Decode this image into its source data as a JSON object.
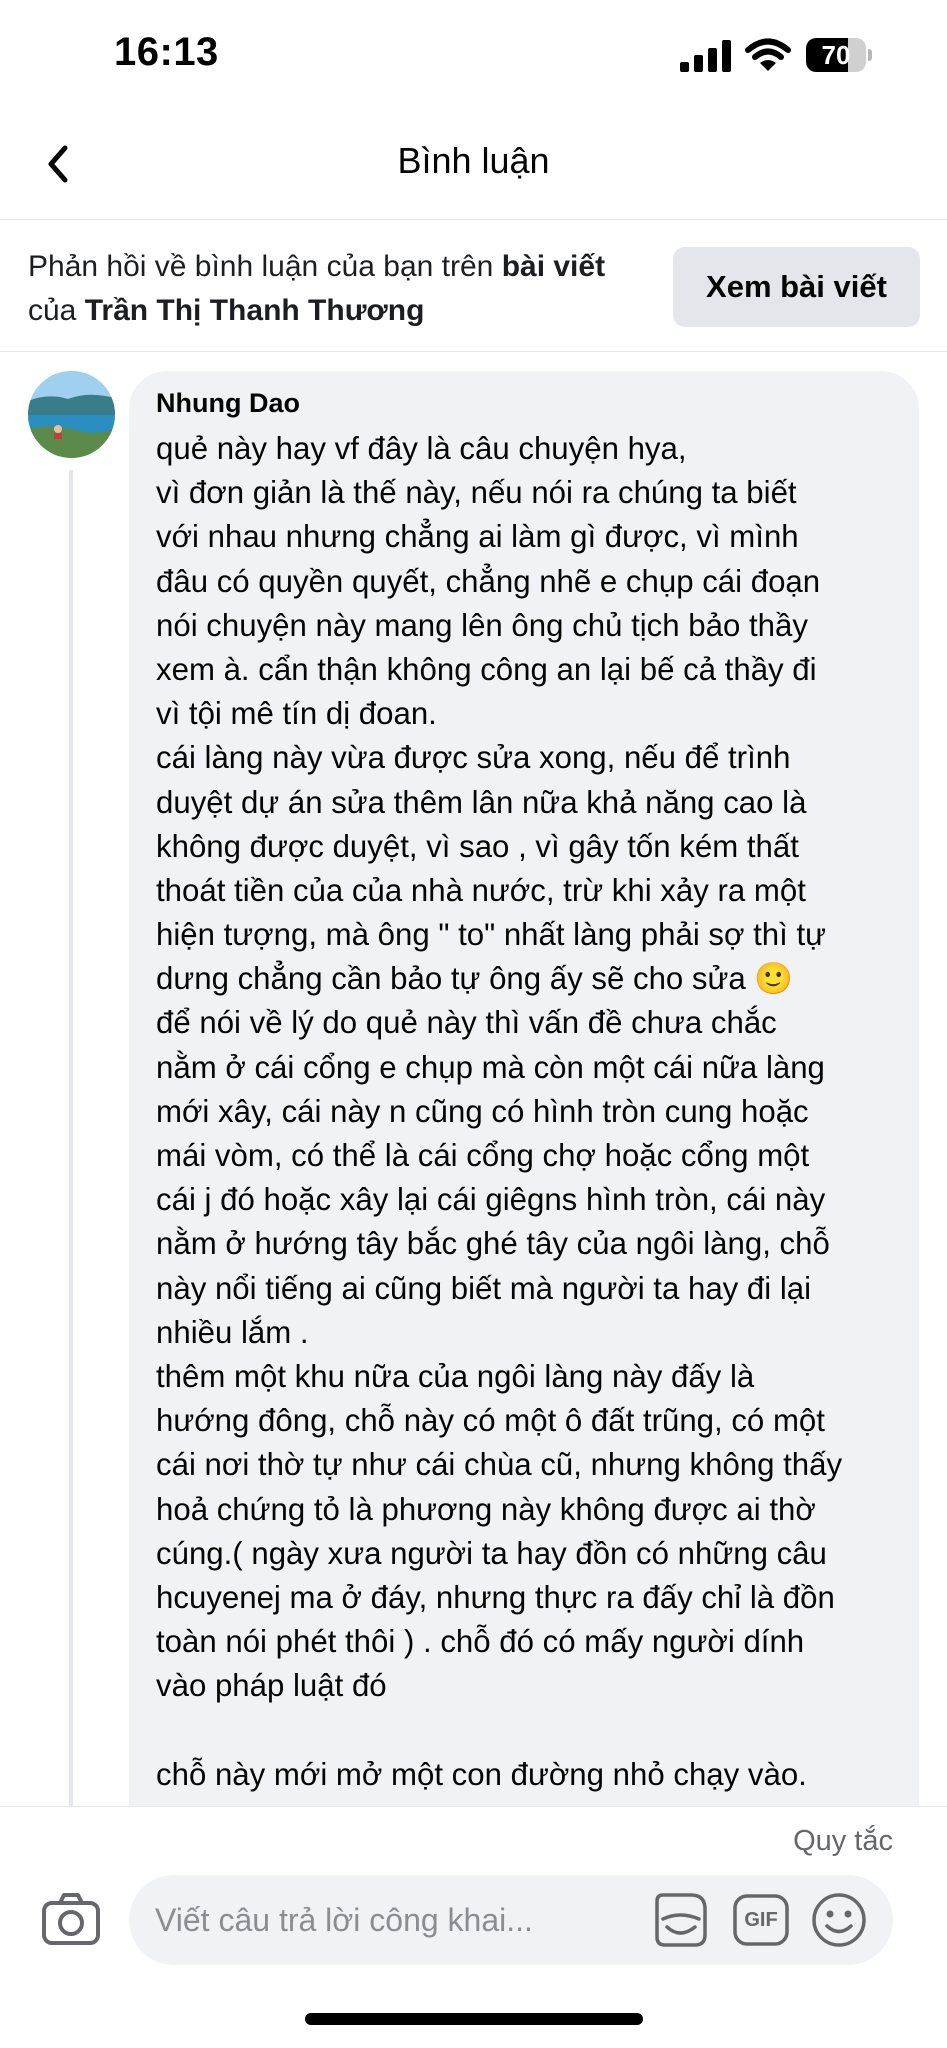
{
  "status_bar": {
    "time": "16:13",
    "battery_level": "70",
    "battery_fraction": 0.7
  },
  "header": {
    "title": "Bình luận",
    "back_icon": "chevron-left-icon"
  },
  "context": {
    "prefix": "Phản hồi về bình luận của bạn trên ",
    "post_link": "bài viết",
    "mid": " của ",
    "owner": "Trần Thị Thanh Thương",
    "view_post_label": "Xem bài viết"
  },
  "comment": {
    "author": "Nhung Dao",
    "lines": [
      "quẻ này hay vf đây là câu chuyện hya,",
      "vì đơn giản là thế này, nếu nói ra chúng ta biết",
      "với nhau nhưng chẳng ai làm gì được, vì mình",
      "đâu có quyền quyết, chẳng nhẽ e chụp cái đoạn",
      "nói chuyện này mang lên ông chủ tịch bảo thầy",
      "xem à. cẩn thận không công an lại bế cả thầy đi",
      "vì tội mê tín dị đoan.",
      "cái làng này vừa được sửa xong, nếu để trình",
      "duyệt dự án sửa thêm lân nữa khả năng cao là",
      "không được duyệt, vì sao , vì gây tốn kém thất",
      "thoát tiền của của nhà nước, trừ khi xảy ra một",
      "hiện tượng, mà ông \" to\" nhất làng phải sợ thì tự",
      "dưng chẳng cần bảo tự ông ấy sẽ cho sửa 🙂",
      "để nói về lý do quẻ này thì vấn đề chưa chắc",
      "nằm ở cái cổng e chụp mà còn một cái nữa làng",
      "mới xây, cái này n cũng có hình tròn cung hoặc",
      "mái vòm, có thể là cái cổng chợ hoặc cổng một",
      "cái j đó hoặc xây lại cái giêgns hình tròn, cái này",
      "nằm ở hướng tây bắc ghé tây của ngôi làng, chỗ",
      "này nổi tiếng ai cũng biết mà người ta hay đi lại",
      "nhiều lắm .",
      "thêm một khu nữa của ngôi làng này đấy là",
      "hướng đông, chỗ này có một ô đất trũng, có một",
      "cái nơi thờ tự như cái chùa cũ, nhưng không thấy",
      "hoả chứng tỏ là phương này không được ai thờ",
      "cúng.( ngày xưa người ta hay đồn có những câu",
      "hcuyenej ma ở đáy, nhưng thực ra đấy chỉ là đồn",
      "toàn nói phét thôi ) . chỗ đó có mấy người dính",
      "vào pháp luật đó",
      "",
      "chỗ này mới mở một con đường nhỏ chạy vào."
    ]
  },
  "composer": {
    "rules_label": "Quy tắc",
    "placeholder": "Viết câu trả lời công khai...",
    "gif_label": "GIF"
  },
  "icons": {
    "camera": "camera-icon",
    "sticker": "sticker-icon",
    "gif": "gif-icon",
    "emoji": "emoji-icon"
  },
  "colors": {
    "bubble": "#f0f2f5",
    "button": "#e4e6eb",
    "muted_text": "#65676b"
  }
}
